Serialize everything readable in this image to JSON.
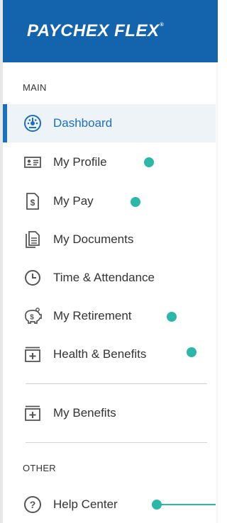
{
  "brand": {
    "logo_text": "PAYCHEX FLEX",
    "logo_mark": "®",
    "color": "#1463ad"
  },
  "accent": "#1b6fbf",
  "marker_color": "#2bb8a8",
  "sections": {
    "main_label": "MAIN",
    "other_label": "OTHER"
  },
  "nav": {
    "dashboard": {
      "label": "Dashboard",
      "icon": "dashboard-gauge-icon",
      "active": true
    },
    "my_profile": {
      "label": "My Profile",
      "icon": "id-card-icon"
    },
    "my_pay": {
      "label": "My Pay",
      "icon": "dollar-document-icon"
    },
    "my_documents": {
      "label": "My Documents",
      "icon": "documents-icon"
    },
    "time_attendance": {
      "label": "Time & Attendance",
      "icon": "clock-icon"
    },
    "my_retirement": {
      "label": "My Retirement",
      "icon": "piggy-bank-icon"
    },
    "health_benefits": {
      "label": "Health & Benefits",
      "icon": "plus-box-icon"
    },
    "my_benefits": {
      "label": "My Benefits",
      "icon": "plus-box-icon"
    },
    "help_center": {
      "label": "Help Center",
      "icon": "question-circle-icon"
    }
  }
}
